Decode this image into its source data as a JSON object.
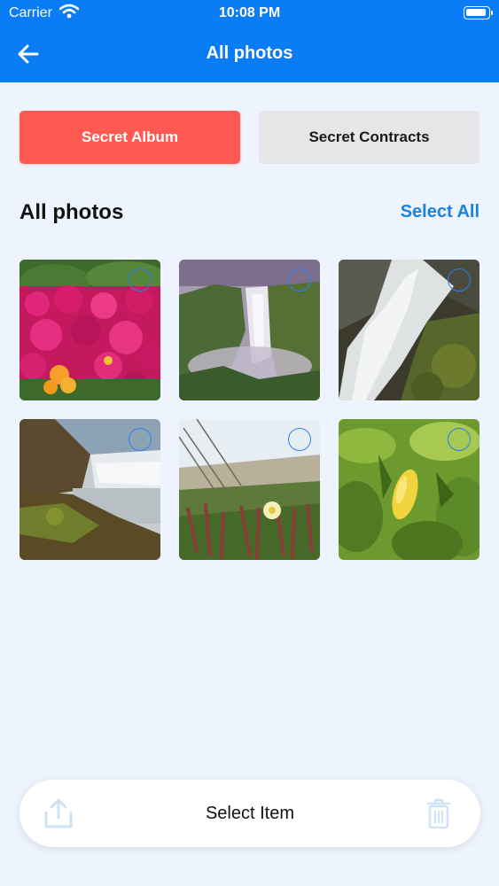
{
  "status_bar": {
    "carrier": "Carrier",
    "time": "10:08 PM"
  },
  "nav": {
    "title": "All photos",
    "back_icon": "arrow-left-icon"
  },
  "tabs": [
    {
      "label": "Secret Album",
      "active": true,
      "color": "#fe5a52"
    },
    {
      "label": "Secret Contracts",
      "active": false,
      "color": "#e6e6e9"
    }
  ],
  "section": {
    "title": "All photos",
    "select_all": "Select All"
  },
  "photos": [
    {
      "subject": "pink-flowers",
      "selected": false
    },
    {
      "subject": "waterfall-cliff",
      "selected": false
    },
    {
      "subject": "waterfall-rocks",
      "selected": false
    },
    {
      "subject": "waterfall-lake",
      "selected": false
    },
    {
      "subject": "coastal-wildflower",
      "selected": false
    },
    {
      "subject": "lemon-tree",
      "selected": false
    }
  ],
  "bottom_bar": {
    "label": "Select Item",
    "share_icon": "share-upload-icon",
    "trash_icon": "trash-icon"
  },
  "colors": {
    "header": "#0a7cf6",
    "accent": "#1a82e2",
    "background": "#eef4fd"
  }
}
